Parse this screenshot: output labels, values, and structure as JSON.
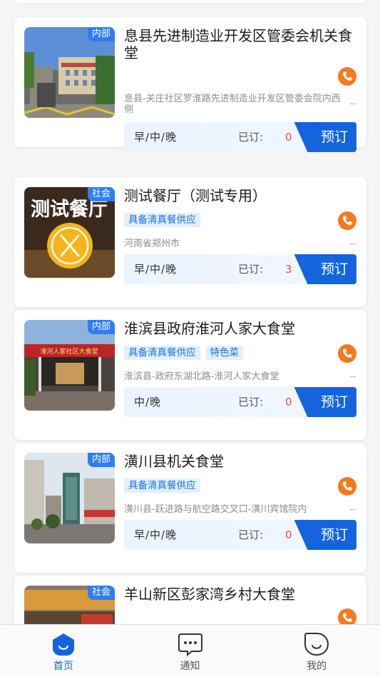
{
  "cards": [
    {
      "category": "内部",
      "title": "息县先进制造业开发区管委会机关食堂",
      "tags": [],
      "address": "息县-关庄社区罗淮路先进制造业开发区管委会院内西侧",
      "distance": "--",
      "meals": "早/中/晚",
      "booked_label": "已订:",
      "booked_count": "0",
      "book_label": "预订",
      "image": "building-photo"
    },
    {
      "category": "社会",
      "title": "测试餐厅（测试专用）",
      "tags": [
        "具备清真餐供应"
      ],
      "address": "河南省郑州市",
      "distance": "--",
      "meals": "早/中/晚",
      "booked_label": "已订:",
      "booked_count": "3",
      "book_label": "预订",
      "image": "test-restaurant-poster",
      "image_text": "测试餐厅"
    },
    {
      "category": "内部",
      "title": "淮滨县政府淮河人家大食堂",
      "tags": [
        "具备清真餐供应",
        "特色菜"
      ],
      "address": "淮滨县-政府东湖北路-淮河人家大食堂",
      "distance": "--",
      "meals": "中/晚",
      "booked_label": "已订:",
      "booked_count": "0",
      "book_label": "预订",
      "image": "canteen-entrance-photo",
      "image_text": "淮河人家社区大食堂"
    },
    {
      "category": "内部",
      "title": "潢川县机关食堂",
      "tags": [
        "具备清真餐供应"
      ],
      "address": "潢川县-跃进路与航空路交叉口-潢川宾馆院内",
      "distance": "--",
      "meals": "早/中/晚",
      "booked_label": "已订:",
      "booked_count": "0",
      "book_label": "预订",
      "image": "street-buildings-photo"
    },
    {
      "category": "社会",
      "title": "羊山新区彭家湾乡村大食堂",
      "tags": [],
      "image": "storefront-photo"
    }
  ],
  "tabbar": [
    {
      "label": "首页",
      "icon": "home-icon",
      "active": true
    },
    {
      "label": "通知",
      "icon": "chat-bubble-icon",
      "active": false
    },
    {
      "label": "我的",
      "icon": "profile-smile-icon",
      "active": false
    }
  ],
  "colors": {
    "accent": "#1465dd",
    "badge": "#2f7df3",
    "tag_bg": "#e2effe",
    "phone": "#f57a1f",
    "count": "#f04a4a"
  }
}
